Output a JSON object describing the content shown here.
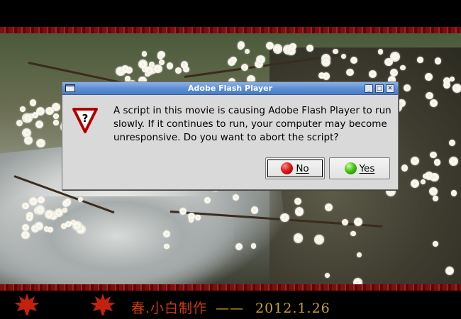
{
  "dialog": {
    "title": "Adobe Flash Player",
    "message": "A script in this movie is causing Adobe Flash Player to run slowly. If it continues to run, your computer may become unresponsive. Do you want to abort the script?",
    "icon": "warning-question-icon",
    "buttons": {
      "no_label": "No",
      "yes_label": "Yes"
    },
    "window_controls": [
      "minimize",
      "maximize",
      "close"
    ]
  },
  "movie": {
    "credit_text": "春.小白制作",
    "credit_dash": "——",
    "credit_date": "2012.1.26"
  },
  "colors": {
    "titlebar": "#5e8fd4",
    "dialog_bg": "#d9d9d9",
    "border_band": "#a82020",
    "credit_red": "#cc3a10",
    "credit_gold": "#c8a41a"
  }
}
